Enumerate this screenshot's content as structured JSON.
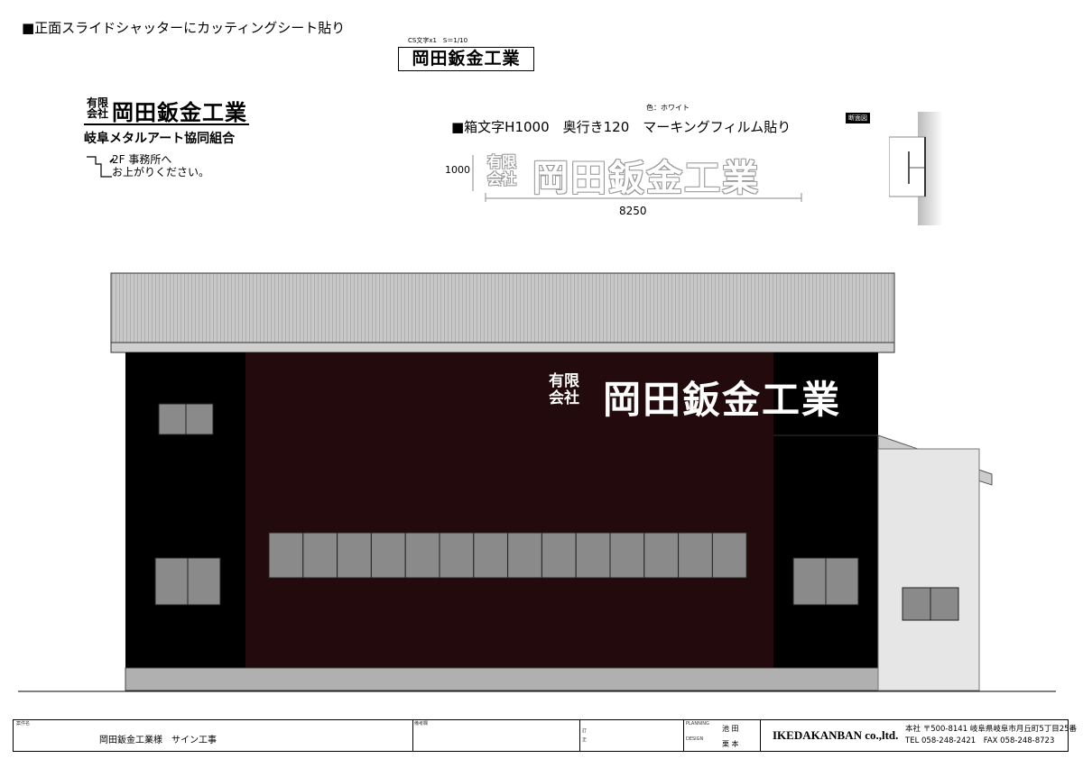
{
  "heading": "■正面スライドシャッターにカッティングシート貼り",
  "cs_note": "CS文字x1　S＝1/10",
  "sample_text": "岡田鈑金工業",
  "left_sign": {
    "company_type_line1": "有限",
    "company_type_line2": "会社",
    "company_name": "岡田鈑金工業",
    "guild": "岐阜メタルアート協同組合",
    "direction_line1": "2F 事務所へ",
    "direction_line2": "お上がりください。"
  },
  "spec": {
    "color_note": "色：ホワイト",
    "description": "■箱文字H1000　奥行き120　マーキングフィルム貼り",
    "section_label": "断面図",
    "height_dim": "1000",
    "width_dim": "8250"
  },
  "building_sign": {
    "company_type_line1": "有限",
    "company_type_line2": "会社",
    "company_name": "岡田鈑金工業"
  },
  "title_block": {
    "project_label": "案件名",
    "project": "岡田鈑金工業様　サイン工事",
    "remarks_label": "備考欄",
    "revision_label_1": "訂",
    "revision_label_2": "正",
    "planning_label": "PLANNING",
    "planning_name": "池 田",
    "design_label": "DESIGN",
    "design_name": "栗 本",
    "company": "IKEDAKANBAN co.,ltd.",
    "address": "本社 〒500-8141 岐阜県岐阜市月丘町5丁目25番",
    "tel": "TEL 058-248-2421　FAX 058-248-8723"
  },
  "colors": {
    "wall_dark_red": "#230a0c",
    "wall_black": "#000000",
    "window_gray": "#8a8a8a",
    "roof_gray": "#c4c4c4",
    "annex_gray": "#e6e6e6"
  }
}
